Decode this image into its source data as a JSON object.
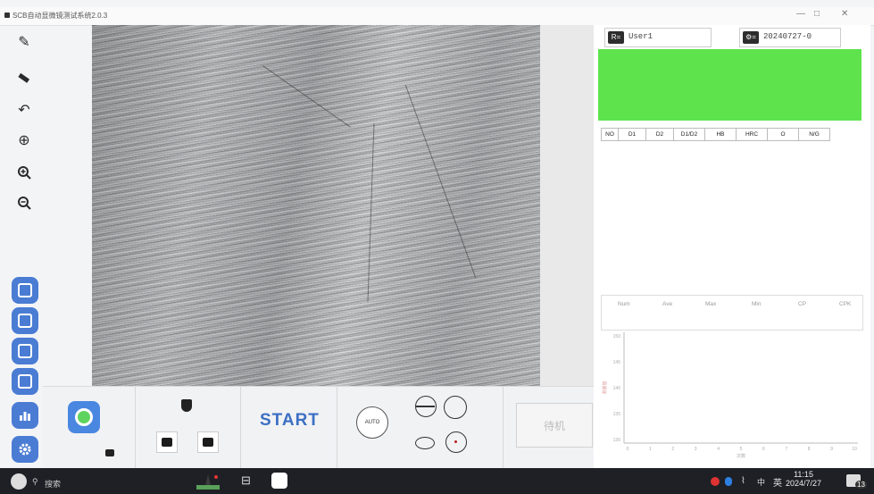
{
  "window": {
    "title": "SCB自动显微镜测试系统2.0.3"
  },
  "user": {
    "name": "User1",
    "date_code": "20240727-0"
  },
  "measure_table": {
    "headers": [
      "NO",
      "D1",
      "D2",
      "D1/D2",
      "HB",
      "HRC",
      "O",
      "N/G"
    ]
  },
  "stats": {
    "headers": [
      "Num",
      "Ave",
      "Max",
      "Min",
      "CP",
      "CPK"
    ]
  },
  "controls": {
    "start_label": "START",
    "auto_label": "AUTO",
    "standby_label": "待机"
  },
  "chart_data": {
    "type": "line",
    "x": [
      0,
      1,
      2,
      3,
      4,
      5,
      6,
      7,
      8,
      9,
      10
    ],
    "series": [],
    "ylim": [
      115,
      150
    ],
    "yticks": [
      "150",
      "145",
      "140",
      "135",
      "130"
    ],
    "xticks": [
      "0",
      "1",
      "2",
      "3",
      "4",
      "5",
      "6",
      "7",
      "8",
      "9",
      "10"
    ],
    "ylabel": "测量值",
    "xlabel": "次数"
  },
  "taskbar": {
    "search_placeholder": "搜索",
    "ime": "英",
    "volume": "中",
    "time": "11:15",
    "date": "2024/7/27",
    "notification_count": "13"
  }
}
